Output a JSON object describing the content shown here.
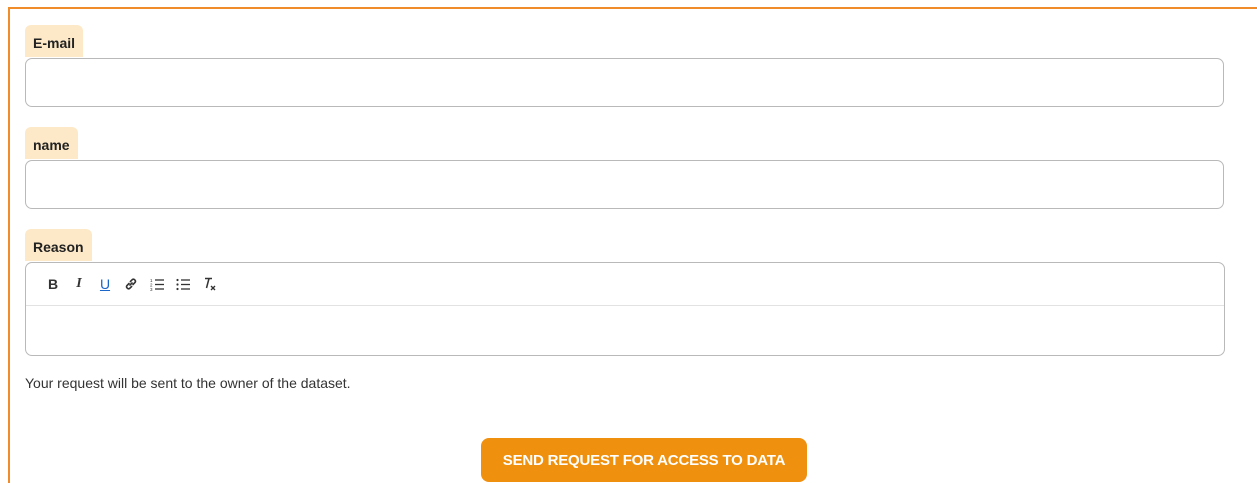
{
  "form": {
    "email_label": "E-mail",
    "email_value": "",
    "name_label": "name",
    "name_value": "",
    "reason_label": "Reason",
    "reason_value": "",
    "toolbar": [
      {
        "icon": "bold-icon",
        "glyph": "B"
      },
      {
        "icon": "italic-icon",
        "glyph": "I"
      },
      {
        "icon": "underline-icon",
        "glyph": "U"
      },
      {
        "icon": "link-icon",
        "glyph": "link"
      },
      {
        "icon": "ordered-list-icon",
        "glyph": "ordered-list"
      },
      {
        "icon": "bullet-list-icon",
        "glyph": "bullet-list"
      },
      {
        "icon": "clear-format-icon",
        "glyph": "clear-format"
      }
    ],
    "note": "Your request will be sent to the owner of the dataset.",
    "submit_label": "SEND REQUEST FOR ACCESS TO DATA"
  },
  "colors": {
    "accent": "#f0900f",
    "frame_border": "#f08c2a",
    "label_bg": "#fde9c8",
    "underline_icon": "#1a66c9"
  }
}
